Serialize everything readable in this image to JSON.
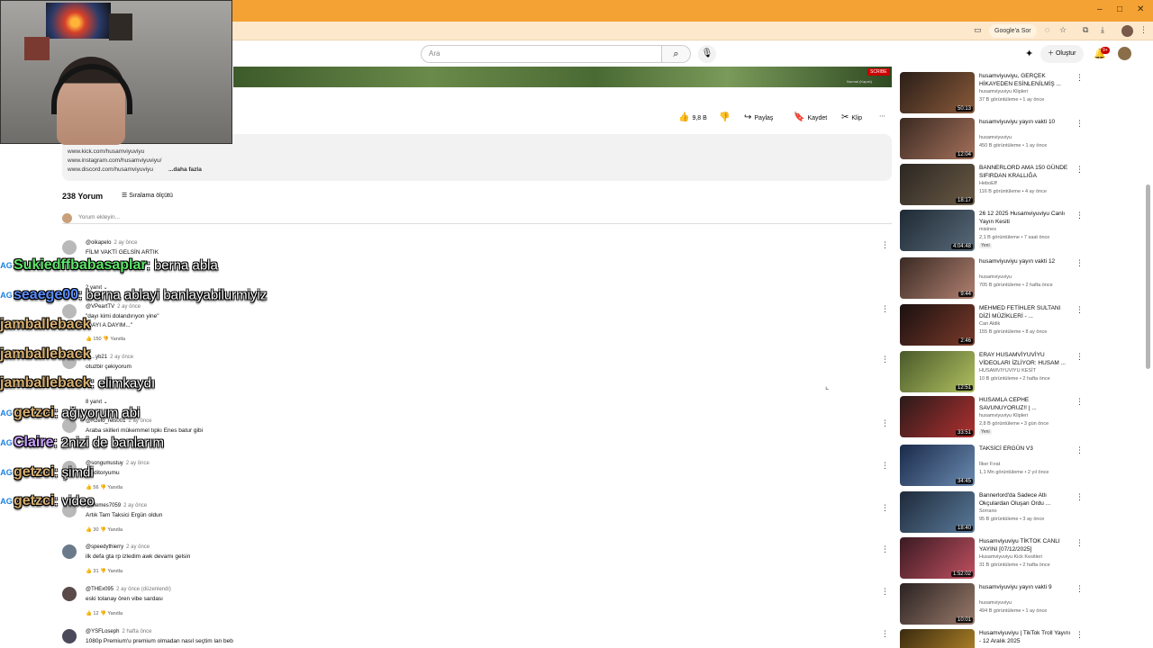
{
  "browser": {
    "window_controls": {
      "minimize": "–",
      "maximize": "□",
      "close": "✕"
    },
    "toolbar_chip": "Google'a Sor"
  },
  "header": {
    "search_placeholder": "Ara",
    "create_label": "Oluştur",
    "notification_count": "9+"
  },
  "video": {
    "overlay_button": "SCRIBE",
    "overlay_caption": "Normal (Kapalı)"
  },
  "actions": {
    "like_count": "9,8 B",
    "share": "Paylaş",
    "save": "Kaydet",
    "clip": "Klip"
  },
  "description": {
    "lines": [
      "www.kick.com/husamviyuviyu",
      "www.instagram.com/husamviyuviyu/",
      "www.discord.com/husamviyuviyu"
    ],
    "more": "...daha fazla"
  },
  "comments": {
    "count_label": "238 Yorum",
    "sort_label": "Sıralama ölçütü",
    "add_placeholder": "Yorum ekleyin...",
    "reply_label": "Yanıtla",
    "items": [
      {
        "author": "@oikapelo",
        "time": "2 ay önce",
        "text": "FİLM VAKTİ GELSİN ARTIK",
        "likes": ""
      },
      {
        "author": "@VPeartTV",
        "time": "2 ay önce",
        "text": "\"dayı kimi dolandırıyon yine\"",
        "text2": "\"DAYI A DAYIM...\"",
        "likes": "150"
      },
      {
        "author": "@...yb21",
        "time": "2 ay önce",
        "text": "otuzbir çekiyorum",
        "likes": ""
      },
      {
        "author": "@Rzelo_reis001",
        "time": "2 ay önce",
        "text": "Araba skilleri mükemmel tıpkı Enes batur gibi",
        "likes": ""
      },
      {
        "author": "@songumustuy",
        "time": "2 ay önce",
        "text": "...editoryumu",
        "likes": "56"
      },
      {
        "author": "@Memes7059",
        "time": "2 ay önce",
        "text": "Artık Tam Taksici Ergün oldun",
        "likes": "30"
      },
      {
        "author": "@speedythierry",
        "time": "2 ay önce",
        "text": "ilk defa gta rp izledim awk devamı gelsin",
        "likes": "31"
      },
      {
        "author": "@THEx095",
        "time": "2 ay önce (düzenlendi)",
        "text": "eski tolanay ören vibe sardası",
        "likes": "12"
      },
      {
        "author": "@YSFLoseph",
        "time": "2 hafta önce",
        "text": "1080p Premium'u premium olmadan nasıl seçtim lan beb",
        "likes": ""
      }
    ],
    "replies": [
      "2 yanıt",
      "8 yanıt"
    ]
  },
  "chat": [
    {
      "badge": "AG",
      "user": "Sukiedffbabasaplar",
      "user_color": "#5ee66a",
      "msg": ": berna abla"
    },
    {
      "badge": "AG",
      "user": "seaege00",
      "user_color": "#5b8dff",
      "msg": ": berna ablayi banlayabilurmiyiz"
    },
    {
      "badge": "",
      "user": "jamballeback",
      "user_color": "#d8b070",
      "msg": ""
    },
    {
      "badge": "",
      "user": "jamballeback",
      "user_color": "#d8b070",
      "msg": ""
    },
    {
      "badge": "",
      "user": "jamballeback",
      "user_color": "#d8b070",
      "msg": ": elimkaydı"
    },
    {
      "badge": "AG",
      "user": "getzci",
      "user_color": "#d8b070",
      "msg": ": ağıyorum abi"
    },
    {
      "badge": "AG",
      "user": "Claire",
      "user_color": "#c9a0ff",
      "msg": ": 2nizi de banlarım"
    },
    {
      "badge": "AG",
      "user": "getzci",
      "user_color": "#d8b070",
      "msg": ": şimdi"
    },
    {
      "badge": "AG",
      "user": "getzci",
      "user_color": "#d8b070",
      "msg": ": video"
    }
  ],
  "sidebar": [
    {
      "title": "husamviyuviyu, GERÇEK HİKAYEDEN ESİNLENİLMİŞ ...",
      "channel": "husamviyuviyu Klipleri",
      "stats": "37 B görüntüleme • 1 ay önce",
      "duration": "50:13",
      "badge": ""
    },
    {
      "title": "husamviyuviyu yayın vakti 10",
      "channel": "husamviyuviyu",
      "stats": "450 B görüntüleme • 1 ay önce",
      "duration": "12:04",
      "badge": ""
    },
    {
      "title": "BANNERLORD AMA 150 GÜNDE SIFIRDAN KRALLIĞA",
      "channel": "HeboEff",
      "stats": "116 B görüntüleme • 4 ay önce",
      "duration": "18:17",
      "badge": ""
    },
    {
      "title": "26 12 2025 Husamviyuviyu Canlı Yayın Kesiti",
      "channel": "mistnes",
      "stats": "2,1 B görüntüleme • 7 saat önce",
      "duration": "4:04:48",
      "badge": "Yeni"
    },
    {
      "title": "husamviyuviyu yayın vakti 12",
      "channel": "husamviyuviyu",
      "stats": "705 B görüntüleme • 2 hafta önce",
      "duration": "9:44",
      "badge": ""
    },
    {
      "title": "MEHMED FETİHLER SULTANI DİZİ MÜZİKLERİ - ...",
      "channel": "Can Aldik",
      "stats": "155 B görüntüleme • 8 ay önce",
      "duration": "2:46",
      "badge": ""
    },
    {
      "title": "ERAY HUSAMVİYUVİYU VİDEOLARI İZLİYOR: HUSAM ...",
      "channel": "HUSAMVIYUVIYU KESİT",
      "stats": "10 B görüntüleme • 2 hafta önce",
      "duration": "12:51",
      "badge": ""
    },
    {
      "title": "HUSAMLA CEPHE SAVUNUYORUZ!! | ...",
      "channel": "husamviyuviyu Klipleri",
      "stats": "2,8 B görüntüleme • 3 gün önce",
      "duration": "33:51",
      "badge": "Yeni"
    },
    {
      "title": "TAKSİCİ ERGÜN V3",
      "channel": "İlker Fırat",
      "stats": "1,1 Mn görüntüleme • 2 yıl önce",
      "duration": "34:45",
      "badge": ""
    },
    {
      "title": "Bannerlord'da Sadece Atlı Okçulardan Oluşan Ordu ...",
      "channel": "Sorrano",
      "stats": "95 B görüntüleme • 3 ay önce",
      "duration": "18:40",
      "badge": ""
    },
    {
      "title": "Husamviyuviyu TİKTOK CANLI YAYINI [07/12/2025]",
      "channel": "Husamviyuviyu Kick Kesitleri",
      "stats": "31 B görüntüleme • 2 hafta önce",
      "duration": "1:52:02",
      "badge": ""
    },
    {
      "title": "husamviyuviyu yayın vakti 9",
      "channel": "husamviyuviyu",
      "stats": "494 B görüntüleme • 1 ay önce",
      "duration": "10:01",
      "badge": ""
    },
    {
      "title": "Husamviyuviyu | TikTok Troll Yayını - 12 Aralık 2025",
      "channel": "",
      "stats": "",
      "duration": "",
      "badge": ""
    }
  ],
  "colors": {
    "browser_tab": "#f4a233",
    "toolbar": "#fde8cc",
    "accent_red": "#cc0000"
  }
}
